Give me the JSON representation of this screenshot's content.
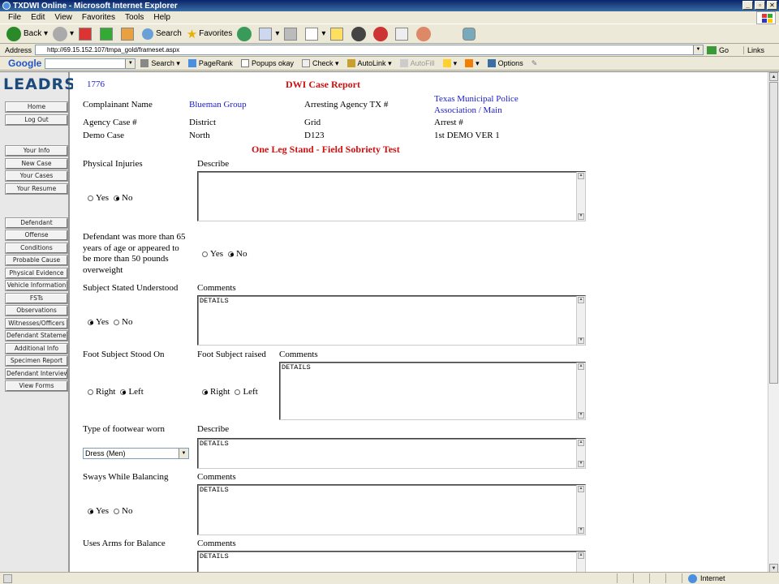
{
  "window": {
    "title": "TXDWI Online - Microsoft Internet Explorer"
  },
  "menu": [
    "File",
    "Edit",
    "View",
    "Favorites",
    "Tools",
    "Help"
  ],
  "toolbar": {
    "back": "Back",
    "search": "Search",
    "favorites": "Favorites"
  },
  "address": {
    "label": "Address",
    "url": "http://69.15.152.107/tmpa_gold/frameset.aspx",
    "go": "Go",
    "links": "Links"
  },
  "google": {
    "logo": "Google",
    "search": "Search",
    "pagerank": "PageRank",
    "popups": "Popups okay",
    "check": "Check",
    "autolink": "AutoLink",
    "autofill": "AutoFill",
    "options": "Options"
  },
  "nav": {
    "logo": "LEADRS",
    "top": [
      "Home",
      "Log Out"
    ],
    "user": [
      "Your Info",
      "New Case",
      "Your Cases",
      "Your Resume"
    ],
    "sections": [
      "Defendant",
      "Offense",
      "Conditions",
      "Probable Cause",
      "Physical Evidence",
      "Vehicle Information",
      "FSTs",
      "Observations",
      "Witnesses/Officers",
      "Defendant Statemer",
      "Additional Info",
      "Specimen Report",
      "Defendant Interview",
      "View Forms"
    ]
  },
  "report": {
    "case_id": "1776",
    "title": "DWI Case Report",
    "complainant_label": "Complainant Name",
    "complainant_value": "Blueman Group",
    "arresting_agency_label": "Arresting Agency TX #",
    "arresting_agency_line1": "Texas Municipal Police",
    "arresting_agency_line2": "Association / Main",
    "agency_case_label": "Agency Case #",
    "agency_case_value": "Demo Case",
    "district_label": "District",
    "district_value": "North",
    "grid_label": "Grid",
    "grid_value": "D123",
    "arrest_label": "Arrest #",
    "arrest_value": "1st DEMO VER 1",
    "test_title": "One Leg Stand - Field Sobriety Test"
  },
  "form": {
    "yes": "Yes",
    "no": "No",
    "right": "Right",
    "left": "Left",
    "describe": "Describe",
    "comments": "Comments",
    "details": "DETAILS",
    "physical_injuries": "Physical Injuries",
    "age_weight_line1": "Defendant was more than 65",
    "age_weight_line2": "years of age or appeared to",
    "age_weight_line3": "be more than 50 pounds",
    "age_weight_line4": "overweight",
    "subject_understood": "Subject Stated Understood",
    "foot_stood": "Foot Subject Stood On",
    "foot_raised": "Foot Subject raised",
    "footwear": "Type of footwear worn",
    "footwear_value": "Dress (Men)",
    "sways": "Sways While Balancing",
    "arms": "Uses Arms for Balance"
  },
  "status": {
    "zone": "Internet"
  }
}
